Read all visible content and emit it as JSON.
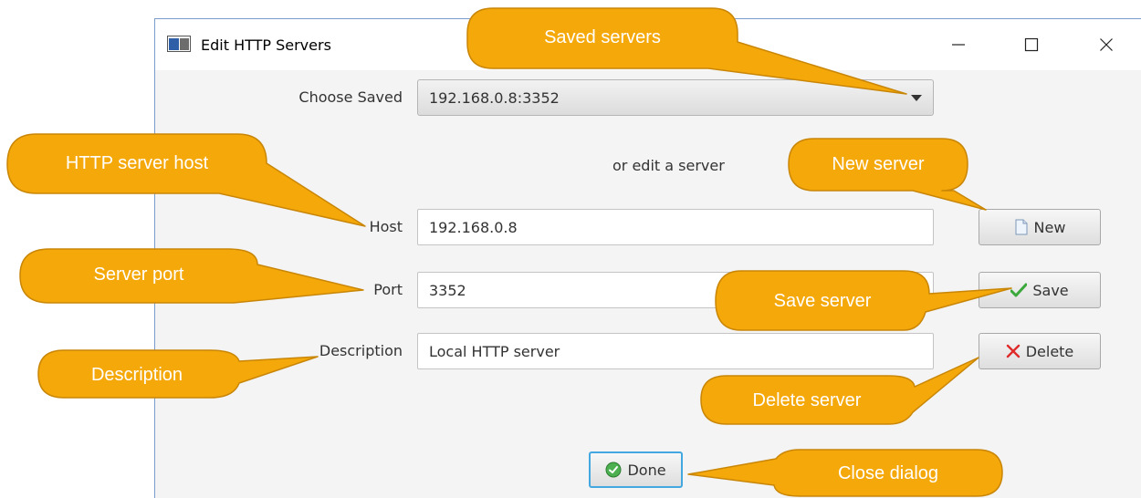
{
  "window": {
    "title": "Edit HTTP Servers"
  },
  "form": {
    "choose_saved_label": "Choose Saved",
    "choose_saved_value": "192.168.0.8:3352",
    "or_edit_text": "or edit a server",
    "host_label": "Host",
    "host_value": "192.168.0.8",
    "port_label": "Port",
    "port_value": "3352",
    "description_label": "Description",
    "description_value": "Local HTTP server"
  },
  "buttons": {
    "new_label": "New",
    "save_label": "Save",
    "delete_label": "Delete",
    "done_label": "Done"
  },
  "callouts": {
    "saved_servers": "Saved servers",
    "http_server_host": "HTTP server host",
    "new_server": "New server",
    "server_port": "Server port",
    "save_server": "Save server",
    "description": "Description",
    "delete_server": "Delete server",
    "close_dialog": "Close dialog"
  },
  "colors": {
    "callout_fill": "#f5a80a",
    "callout_stroke": "#c98606",
    "window_border": "#7a9ccc",
    "done_focus": "#43a8e0",
    "save_check": "#3aa83a",
    "delete_x": "#e02a2a"
  }
}
